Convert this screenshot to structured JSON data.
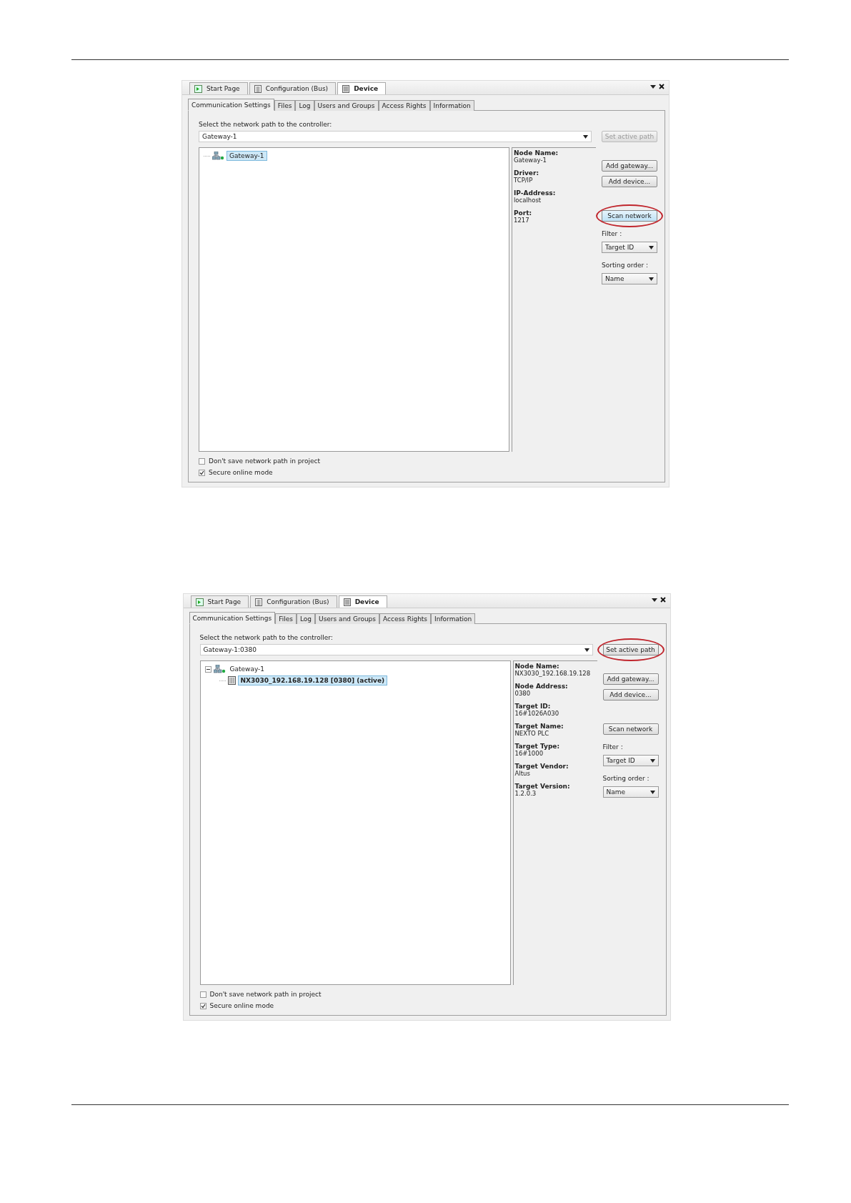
{
  "screenshots": [
    {
      "doc_tabs": [
        {
          "label": "Start Page",
          "kind": "start",
          "selected": false
        },
        {
          "label": "Configuration (Bus)",
          "kind": "config",
          "selected": false
        },
        {
          "label": "Device",
          "kind": "device",
          "selected": true
        }
      ],
      "tabs": [
        {
          "label": "Communication Settings",
          "selected": true
        },
        {
          "label": "Files",
          "selected": false
        },
        {
          "label": "Log",
          "selected": false
        },
        {
          "label": "Users and Groups",
          "selected": false
        },
        {
          "label": "Access Rights",
          "selected": false
        },
        {
          "label": "Information",
          "selected": false
        }
      ],
      "path_label": "Select the network path to the controller:",
      "path_value": "Gateway-1",
      "set_active_path": {
        "label": "Set active path",
        "disabled": true,
        "circled": false
      },
      "tree": [
        {
          "label": "Gateway-1",
          "kind": "gateway",
          "selected": true,
          "active": false,
          "expanded": false
        }
      ],
      "details": [
        {
          "label": "Node Name:",
          "value": "Gateway-1"
        },
        {
          "label": "Driver:",
          "value": "TCP/IP"
        },
        {
          "label": "IP-Address:",
          "value": "localhost"
        },
        {
          "label": "Port:",
          "value": "1217"
        }
      ],
      "buttons": [
        {
          "label": "Add gateway...",
          "hovered": false,
          "circled": false
        },
        {
          "label": "Add device...",
          "hovered": false,
          "circled": false
        },
        {
          "label": "Scan network",
          "hovered": true,
          "circled": true
        }
      ],
      "filter": {
        "label": "Filter :",
        "value": "Target ID"
      },
      "sorting": {
        "label": "Sorting order :",
        "value": "Name"
      },
      "checkboxes": [
        {
          "label": "Don't save network path in project",
          "checked": false
        },
        {
          "label": "Secure online mode",
          "checked": true
        }
      ]
    },
    {
      "doc_tabs": [
        {
          "label": "Start Page",
          "kind": "start",
          "selected": false
        },
        {
          "label": "Configuration (Bus)",
          "kind": "config",
          "selected": false
        },
        {
          "label": "Device",
          "kind": "device",
          "selected": true
        }
      ],
      "tabs": [
        {
          "label": "Communication Settings",
          "selected": true
        },
        {
          "label": "Files",
          "selected": false
        },
        {
          "label": "Log",
          "selected": false
        },
        {
          "label": "Users and Groups",
          "selected": false
        },
        {
          "label": "Access Rights",
          "selected": false
        },
        {
          "label": "Information",
          "selected": false
        }
      ],
      "path_label": "Select the network path to the controller:",
      "path_value": "Gateway-1:0380",
      "set_active_path": {
        "label": "Set active path",
        "disabled": false,
        "circled": true
      },
      "tree": [
        {
          "label": "Gateway-1",
          "kind": "gateway",
          "selected": false,
          "active": false,
          "expanded": true,
          "children": [
            {
              "label": "NX3030_192.168.19.128 [0380] (active)",
              "kind": "device",
              "selected": true,
              "active": true,
              "expanded": false
            }
          ]
        }
      ],
      "details": [
        {
          "label": "Node Name:",
          "value": "NX3030_192.168.19.128"
        },
        {
          "label": "Node Address:",
          "value": "0380"
        },
        {
          "label": "Target ID:",
          "value": "16#1026A030"
        },
        {
          "label": "Target Name:",
          "value": "NEXTO PLC"
        },
        {
          "label": "Target Type:",
          "value": "16#1000"
        },
        {
          "label": "Target Vendor:",
          "value": "Altus"
        },
        {
          "label": "Target Version:",
          "value": "1.2.0.3"
        }
      ],
      "buttons": [
        {
          "label": "Add gateway...",
          "hovered": false,
          "circled": false
        },
        {
          "label": "Add device...",
          "hovered": false,
          "circled": false
        },
        {
          "label": "Scan network",
          "hovered": false,
          "circled": false
        }
      ],
      "filter": {
        "label": "Filter :",
        "value": "Target ID"
      },
      "sorting": {
        "label": "Sorting order :",
        "value": "Name"
      },
      "checkboxes": [
        {
          "label": "Don't save network path in project",
          "checked": false
        },
        {
          "label": "Secure online mode",
          "checked": true
        }
      ]
    }
  ]
}
